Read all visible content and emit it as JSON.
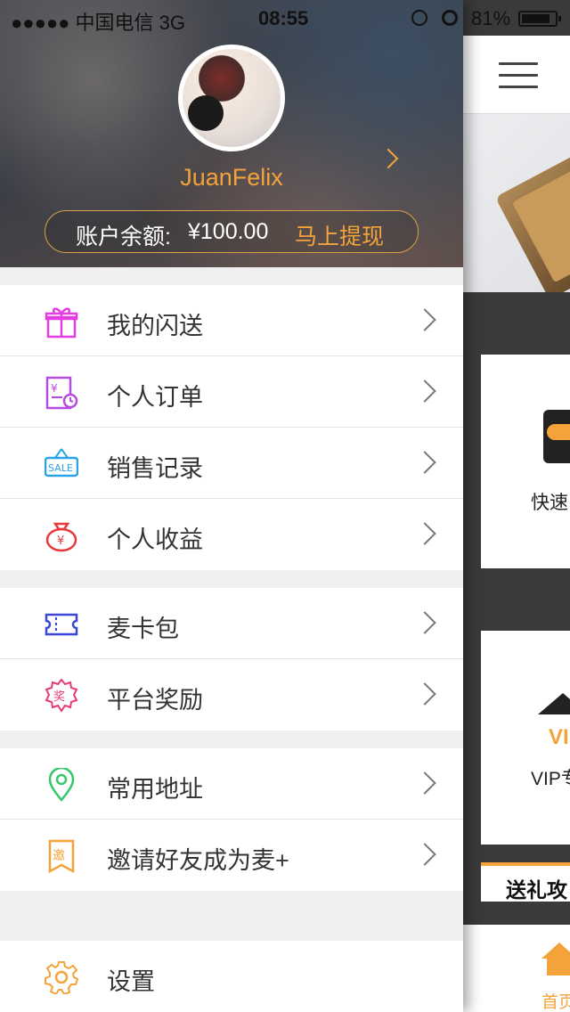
{
  "status_bar": {
    "carrier": "●●●●● 中国电信  3G",
    "time": "08:55",
    "battery": "81%"
  },
  "profile": {
    "username": "JuanFelix",
    "balance_label": "账户余额:",
    "balance_amount": "¥100.00",
    "withdraw_label": "马上提现"
  },
  "menu": {
    "group1": [
      {
        "label": "我的闪送",
        "icon": "gift-icon",
        "color": "#e23fe0"
      },
      {
        "label": "个人订单",
        "icon": "order-icon",
        "color": "#b54be0"
      },
      {
        "label": "销售记录",
        "icon": "sale-tag-icon",
        "color": "#2aa3e6"
      },
      {
        "label": "个人收益",
        "icon": "money-bag-icon",
        "color": "#e8383a"
      }
    ],
    "group2": [
      {
        "label": "麦卡包",
        "icon": "ticket-icon",
        "color": "#3a47d8"
      },
      {
        "label": "平台奖励",
        "icon": "award-badge-icon",
        "color": "#e83a7a"
      }
    ],
    "group3": [
      {
        "label": "常用地址",
        "icon": "location-pin-icon",
        "color": "#35c86b"
      },
      {
        "label": "邀请好友成为麦+",
        "icon": "invite-icon",
        "color": "#f3a33a"
      }
    ],
    "group4": [
      {
        "label": "设置",
        "icon": "settings-gear-icon",
        "color": "#f3a33a"
      }
    ]
  },
  "background_page": {
    "card1_label": "快速",
    "card2_label": "VIP专",
    "vip_text": "VI",
    "gift_strip": "送礼攻",
    "tab_home": "首页"
  }
}
